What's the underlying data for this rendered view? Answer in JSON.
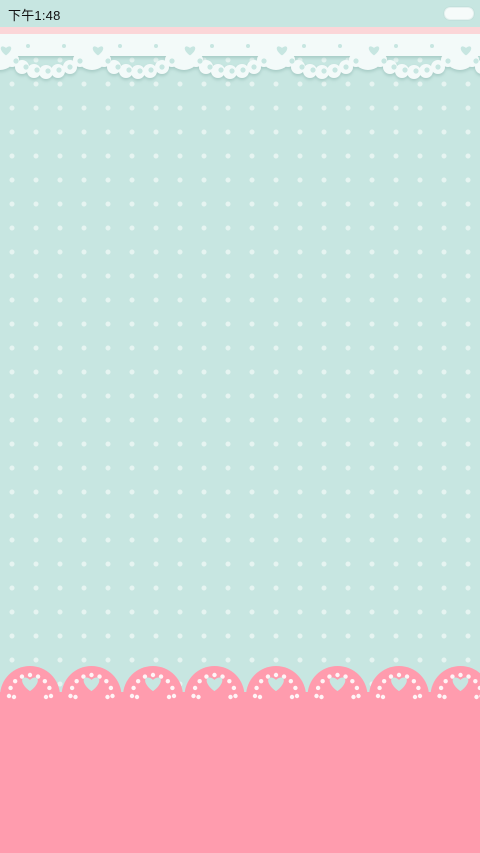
{
  "status_bar": {
    "time": "下午1:48",
    "battery_icon": "battery-icon"
  },
  "theme": {
    "background": "#c7e6e1",
    "dot": "#e9f6f4",
    "lace_white": "#f3faf9",
    "pink_strip": "#fbd6d8",
    "pink_footer": "#ff9cae"
  },
  "decor": {
    "top_lace_icon": "lace-heart-icon",
    "bottom_lace_icon": "pink-lace-heart-icon"
  }
}
